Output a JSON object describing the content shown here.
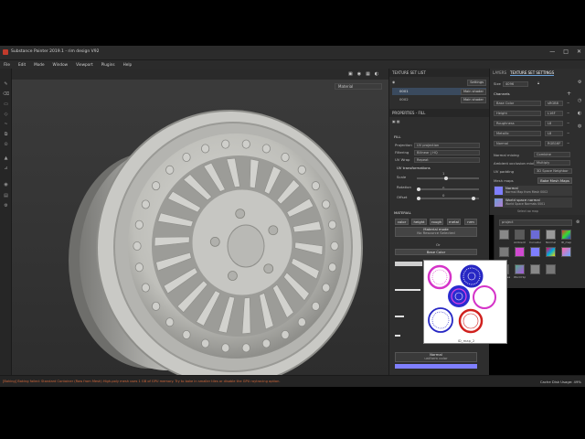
{
  "window": {
    "title": "Substance Painter 2019.1 - rim design V92",
    "controls": [
      "—",
      "□",
      "✕"
    ]
  },
  "menu": [
    "File",
    "Edit",
    "Mode",
    "Window",
    "Viewport",
    "Plugins",
    "Help"
  ],
  "viewport": {
    "material_select": "Material",
    "axis_y": "Y",
    "axis_z": "Z"
  },
  "texture_set_list": {
    "header": "TEXTURE SET LIST",
    "settings_label": "Settings",
    "items": [
      {
        "name": "0001",
        "shader": "Main shader"
      },
      {
        "name": "0002",
        "shader": "Main shader"
      }
    ]
  },
  "properties": {
    "header": "PROPERTIES - FILL",
    "fill_title": "FILL",
    "projection_label": "Projection",
    "projection_value": "UV projection",
    "filtering_label": "Filtering",
    "filtering_value": "Bilinear | HQ",
    "uv_wrap_label": "UV Wrap",
    "uv_wrap_value": "Repeat",
    "uv_transform_title": "UV transformations",
    "scale_label": "Scale",
    "scale_value": "1",
    "rotation_label": "Rotation",
    "rotation_value": "0",
    "offset_label": "Offset",
    "offset_value": "0",
    "material_title": "MATERIAL",
    "channels": [
      "color",
      "height",
      "rough",
      "metal",
      "nrm"
    ],
    "material_mode": "Material mode",
    "no_resource": "No Resource Selected",
    "or_label": "Or",
    "base_color": "Base Color",
    "normal_label": "Normal",
    "normal_value": "uniform color"
  },
  "layers_tabs": {
    "layers": "LAYERS",
    "texture_set_settings": "TEXTURE SET SETTINGS"
  },
  "texture_set_settings": {
    "size_label": "Size",
    "size_value": "4096",
    "channels_title": "Channels",
    "channels": [
      {
        "name": "Base Color",
        "format": "sRGB8"
      },
      {
        "name": "Height",
        "format": "L16F"
      },
      {
        "name": "Roughness",
        "format": "L8"
      },
      {
        "name": "Metallic",
        "format": "L8"
      },
      {
        "name": "Normal",
        "format": "RGB16F"
      }
    ],
    "normal_mixing_label": "Normal mixing",
    "normal_mixing_value": "Combine",
    "ao_mixing_label": "Ambient occlusion mixing",
    "ao_mixing_value": "Multiply",
    "uv_padding_label": "UV padding",
    "uv_padding_value": "3D Space Neighbor",
    "mesh_maps_label": "Mesh maps",
    "bake_button": "Bake Mesh Maps",
    "mesh_maps": [
      {
        "title": "Normal",
        "sub": "Normal Map from Mesh 0002"
      },
      {
        "title": "World space normal",
        "sub": "World Space Normals 0001"
      }
    ],
    "select_map": "Select ao map"
  },
  "shelf": {
    "search_value": "project",
    "items": [
      "",
      "Ambient",
      "Curvature",
      "Normal",
      "ID_map",
      "",
      "",
      "",
      "",
      "",
      "Thickness",
      "World Sp.",
      "",
      ""
    ]
  },
  "popup": {
    "label": "ID_map_2"
  },
  "status": {
    "message": "[Baking] Baking failed: Standard Container (Raw from Mesh) High-poly mesh uses 1 GB of GPU memory. Try to bake in smaller tiles or disable the GPU raytracing option.",
    "right": "Cache Disk Usage: 49%"
  },
  "colors": {
    "accent": "#6aa0d8",
    "warning": "#d2683a",
    "normal_blue": "#7f7fff"
  }
}
